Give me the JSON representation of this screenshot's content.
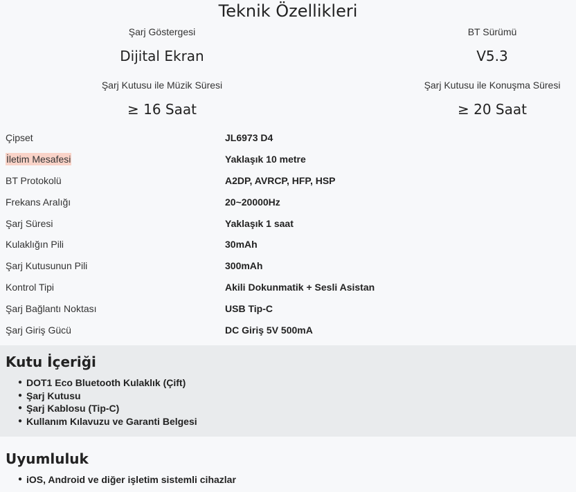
{
  "page_title": "Teknik Özellikleri",
  "highlights": [
    {
      "label": "Şarj Göstergesi",
      "value": "Dijital Ekran"
    },
    {
      "label": "BT Sürümü",
      "value": "V5.3"
    },
    {
      "label": "Şarj Kutusu ile Müzik Süresi",
      "value": "≥ 16 Saat"
    },
    {
      "label": "Şarj Kutusu ile Konuşma Süresi",
      "value": "≥ 20 Saat"
    }
  ],
  "specs": [
    {
      "key": "Çipset",
      "value": "JL6973 D4"
    },
    {
      "key": "İletim Mesafesi",
      "value": "Yaklaşık 10 metre"
    },
    {
      "key": "BT Protokolü",
      "value": "A2DP, AVRCP, HFP, HSP"
    },
    {
      "key": "Frekans Aralığı",
      "value": "20~20000Hz"
    },
    {
      "key": "Şarj Süresi",
      "value": "Yaklaşık 1 saat"
    },
    {
      "key": "Kulaklığın Pili",
      "value": "30mAh"
    },
    {
      "key": "Şarj Kutusunun Pili",
      "value": "300mAh"
    },
    {
      "key": "Kontrol Tipi",
      "value": "Akili Dokunmatik + Sesli Asistan"
    },
    {
      "key": "Şarj Bağlantı Noktası",
      "value": "USB Tip-C"
    },
    {
      "key": "Şarj Giriş Gücü",
      "value": "DC Giriş 5V 500mA"
    }
  ],
  "box_contents": {
    "title": "Kutu İçeriği",
    "items": [
      "DOT1 Eco Bluetooth Kulaklık (Çift)",
      "Şarj Kutusu",
      "Şarj Kablosu (Tip-C)",
      "Kullanım Kılavuzu ve Garanti Belgesi"
    ]
  },
  "compatibility": {
    "title": "Uyumluluk",
    "items": [
      "iOS, Android ve diğer işletim sistemli cihazlar"
    ]
  },
  "colors": {
    "background": "#f7f8fa",
    "section_background": "#e9ebed",
    "highlight": "#f9d3c8"
  }
}
